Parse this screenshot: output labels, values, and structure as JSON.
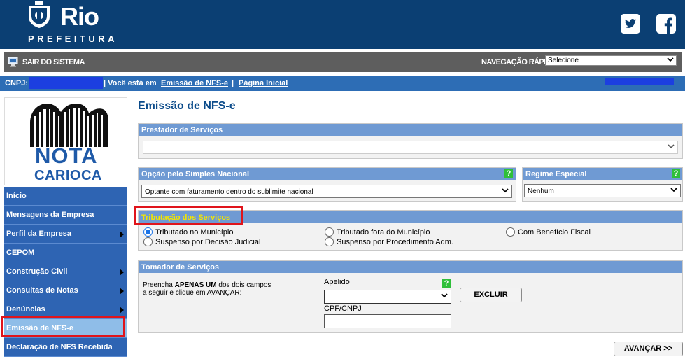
{
  "header": {
    "logo_word": "Rio",
    "logo_sub": "PREFEITURA"
  },
  "toolbar": {
    "exit_label": "SAIR DO SISTEMA",
    "quick_nav_label": "NAVEGAÇÃO RÁPIDA",
    "quick_nav_value": "Selecione"
  },
  "infobar": {
    "cnpj_label": "CNPJ:",
    "you_are_in": "| Você está em",
    "current_page": "Emissão de NFS-e",
    "separator": "|",
    "home_link": "Página Inicial"
  },
  "sidebar": {
    "logo_line1": "NOTA",
    "logo_line2": "CARIOCA",
    "items": [
      {
        "label": "Início",
        "submenu": false
      },
      {
        "label": "Mensagens da Empresa",
        "submenu": false
      },
      {
        "label": "Perfil da Empresa",
        "submenu": true
      },
      {
        "label": "CEPOM",
        "submenu": false
      },
      {
        "label": "Construção Civil",
        "submenu": true
      },
      {
        "label": "Consultas de Notas",
        "submenu": true
      },
      {
        "label": "Denúncias",
        "submenu": true
      },
      {
        "label": "Emissão de NFS-e",
        "submenu": false,
        "active": true
      },
      {
        "label": "Declaração de NFS Recebida",
        "submenu": false
      }
    ]
  },
  "main": {
    "title": "Emissão de NFS-e",
    "prestador": {
      "heading": "Prestador de Serviços",
      "value": ""
    },
    "simples": {
      "heading": "Opção pelo Simples Nacional",
      "help": "?",
      "value": "Optante com faturamento dentro do sublimite nacional"
    },
    "regime": {
      "heading": "Regime Especial",
      "help": "?",
      "value": "Nenhum"
    },
    "tributacao": {
      "heading": "Tributação dos Serviços",
      "options": [
        {
          "label": "Tributado no Município",
          "checked": true
        },
        {
          "label": "Tributado fora do Município",
          "checked": false
        },
        {
          "label": "Com Benefício Fiscal",
          "checked": false
        },
        {
          "label": "Suspenso por Decisão Judicial",
          "checked": false
        },
        {
          "label": "Suspenso por Procedimento Adm.",
          "checked": false
        }
      ]
    },
    "tomador": {
      "heading": "Tomador de Serviços",
      "instruction_pre": "Preencha ",
      "instruction_bold": "APENAS UM",
      "instruction_post": " dos dois campos",
      "instruction_line2": "a seguir e clique em AVANÇAR:",
      "apelido_label": "Apelido",
      "apelido_value": "",
      "help": "?",
      "cpf_label": "CPF/CNPJ",
      "cpf_value": "",
      "excluir_label": "EXCLUIR"
    },
    "avancar_label": "AVANÇAR >>"
  }
}
